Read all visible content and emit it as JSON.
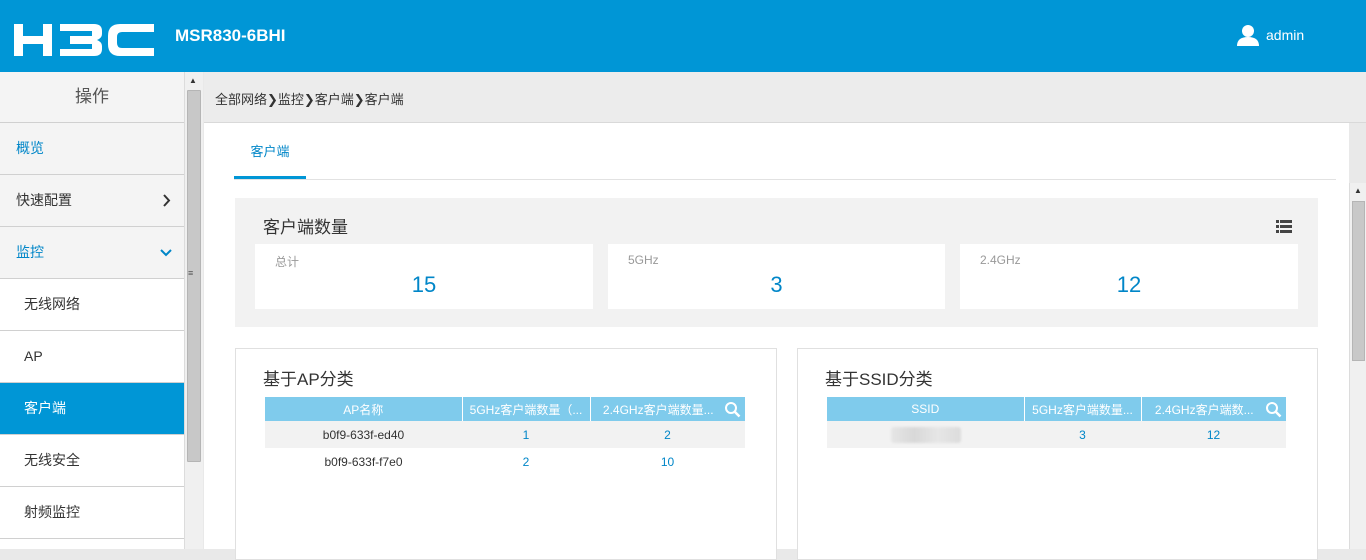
{
  "header": {
    "logo": "H3C",
    "model": "MSR830-6BHI",
    "user": "admin"
  },
  "sidebar": {
    "title": "操作",
    "items": [
      {
        "label": "概览"
      },
      {
        "label": "快速配置"
      },
      {
        "label": "监控"
      }
    ],
    "sub_items": [
      {
        "label": "无线网络"
      },
      {
        "label": "AP"
      },
      {
        "label": "客户端"
      },
      {
        "label": "无线安全"
      },
      {
        "label": "射频监控"
      }
    ]
  },
  "breadcrumb": {
    "text": "全部网络❯监控❯客户端❯客户端"
  },
  "tabs": [
    {
      "label": "客户端"
    }
  ],
  "client_count": {
    "title": "客户端数量",
    "cards": [
      {
        "label": "总计",
        "value": "15"
      },
      {
        "label": "5GHz",
        "value": "3"
      },
      {
        "label": "2.4GHz",
        "value": "12"
      }
    ]
  },
  "by_ap": {
    "title": "基于AP分类",
    "headers": [
      "AP名称",
      "5GHz客户端数量（...",
      "2.4GHz客户端数量..."
    ],
    "rows": [
      [
        "b0f9-633f-ed40",
        "1",
        "2"
      ],
      [
        "b0f9-633f-f7e0",
        "2",
        "10"
      ]
    ]
  },
  "by_ssid": {
    "title": "基于SSID分类",
    "headers": [
      "SSID",
      "5GHz客户端数量...",
      "2.4GHz客户端数..."
    ],
    "rows": [
      [
        "",
        "3",
        "12"
      ]
    ]
  },
  "colors": {
    "brand": "#0096d6",
    "accent_text": "#0086c8",
    "table_header": "#7fcbec"
  },
  "icons": [
    "h3c-logo",
    "user-icon",
    "chevron-right-icon",
    "chevron-down-icon",
    "list-icon",
    "search-icon"
  ]
}
